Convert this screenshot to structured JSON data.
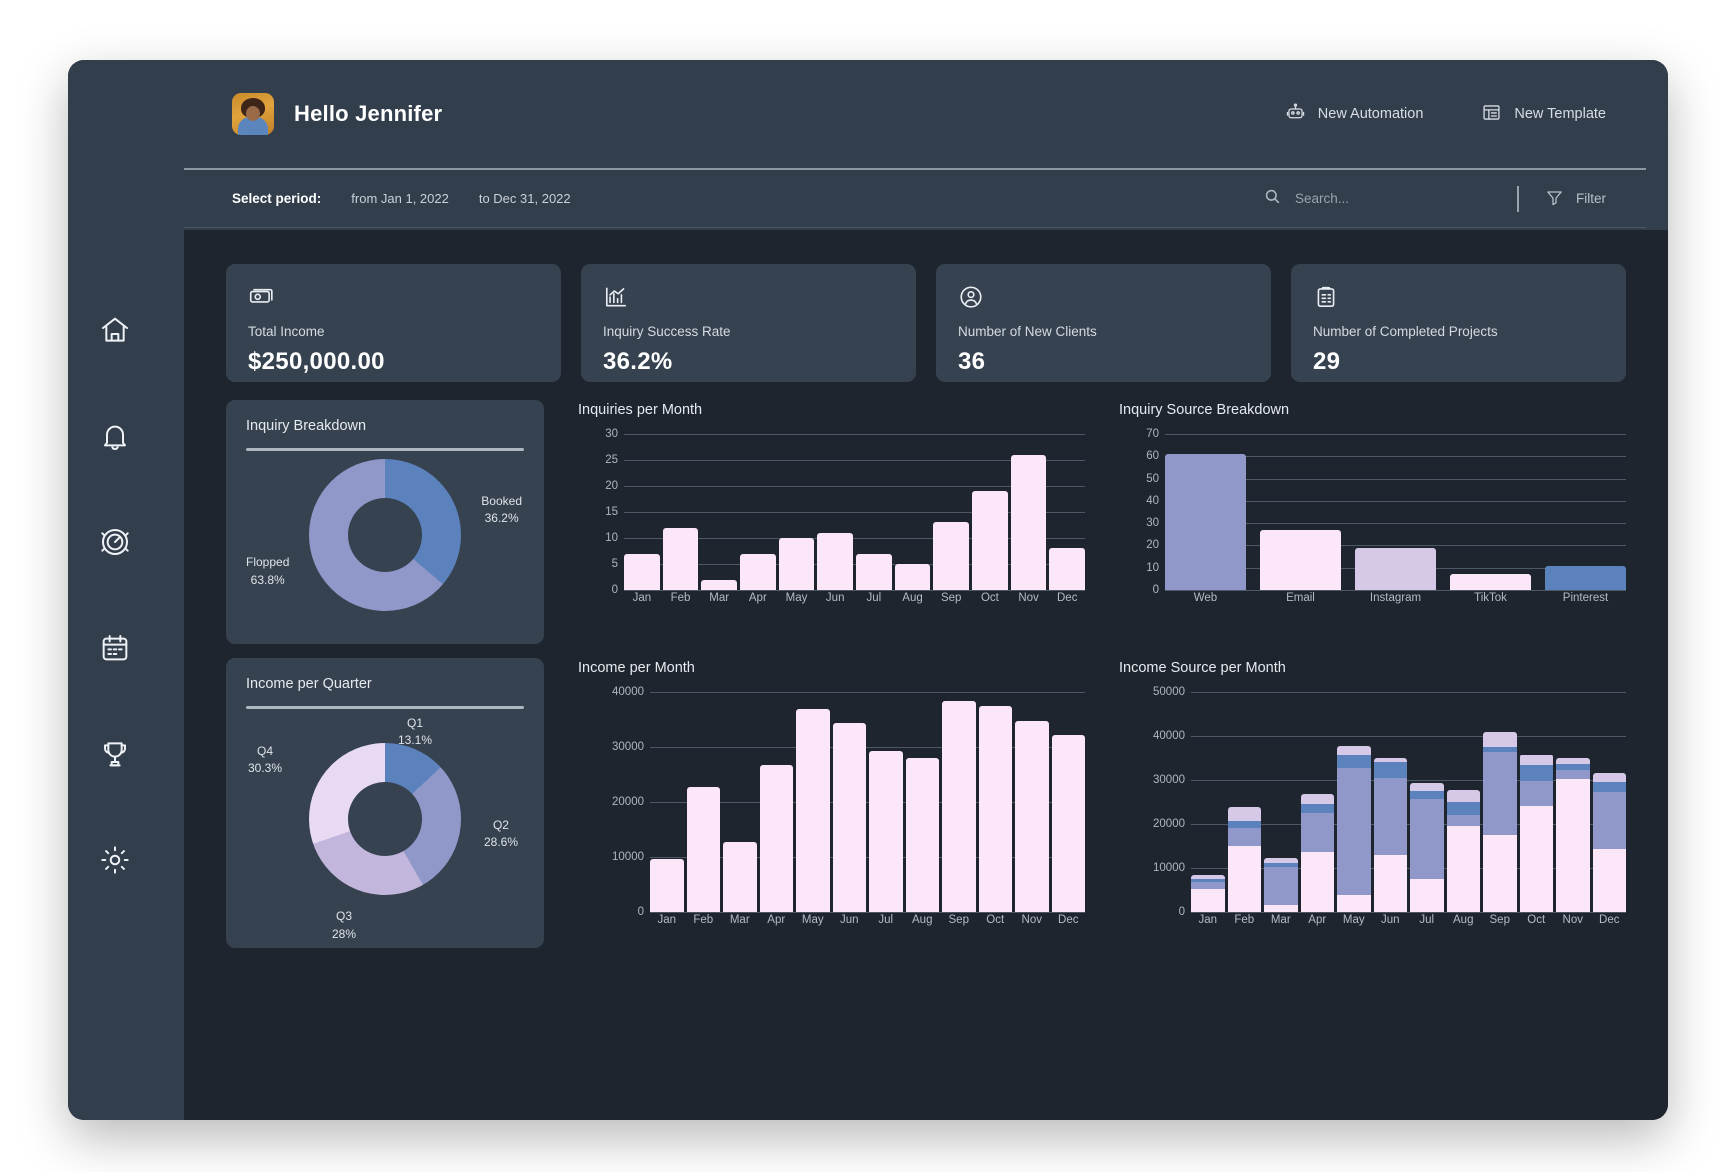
{
  "sidebar": {
    "items": [
      {
        "name": "home",
        "icon": "home-icon"
      },
      {
        "name": "notifications",
        "icon": "bell-icon"
      },
      {
        "name": "performance",
        "icon": "gauge-icon"
      },
      {
        "name": "calendar",
        "icon": "calendar-icon"
      },
      {
        "name": "awards",
        "icon": "trophy-icon"
      },
      {
        "name": "settings",
        "icon": "gear-icon"
      }
    ]
  },
  "header": {
    "greeting": "Hello Jennifer",
    "avatar_alt": "user-avatar",
    "actions": [
      {
        "label": "New Automation",
        "icon": "robot-icon"
      },
      {
        "label": "New Template",
        "icon": "template-icon"
      }
    ]
  },
  "period": {
    "label": "Select period:",
    "from": "from Jan 1, 2022",
    "to": "to Dec 31, 2022",
    "search_placeholder": "Search...",
    "search_value": "",
    "filter_label": "Filter"
  },
  "kpis": [
    {
      "icon": "money-icon",
      "label": "Total Income",
      "value": "$250,000.00"
    },
    {
      "icon": "chart-icon",
      "label": "Inquiry Success Rate",
      "value": "36.2%"
    },
    {
      "icon": "user-icon",
      "label": "Number of New Clients",
      "value": "36"
    },
    {
      "icon": "clipboard-icon",
      "label": "Number of Completed Projects",
      "value": "29"
    }
  ],
  "colors": {
    "pink": "#fbe7f8",
    "lavender": "#d6c9e8",
    "periwinkle": "#9098c9",
    "blue": "#5c82bd",
    "panel": "#36424f",
    "bg": "#1e252e",
    "chrome": "#323e4c"
  },
  "chart_data": [
    {
      "id": "inquiry-breakdown",
      "type": "pie",
      "title": "Inquiry Breakdown",
      "categories": [
        "Booked",
        "Flopped"
      ],
      "values": [
        36.2,
        63.8
      ],
      "labels": [
        "36.2%",
        "63.8%"
      ],
      "colors": [
        "#5c82bd",
        "#9098c9"
      ],
      "donut": true,
      "legend": "callout-labels"
    },
    {
      "id": "inquiries-per-month",
      "type": "bar",
      "title": "Inquiries per Month",
      "categories": [
        "Jan",
        "Feb",
        "Mar",
        "Apr",
        "May",
        "Jun",
        "Jul",
        "Aug",
        "Sep",
        "Oct",
        "Nov",
        "Dec"
      ],
      "values": [
        7,
        12,
        2,
        7,
        10,
        11,
        7,
        5,
        13,
        19,
        26,
        8
      ],
      "ylabel": "",
      "xlabel": "",
      "ylim": [
        0,
        30
      ],
      "yticks": [
        0,
        5,
        10,
        15,
        20,
        25,
        30
      ],
      "grid": true,
      "color": "#fbe7f8"
    },
    {
      "id": "inquiry-source-breakdown",
      "type": "bar",
      "title": "Inquiry Source Breakdown",
      "categories": [
        "Web",
        "Email",
        "Instagram",
        "TikTok",
        "Pinterest"
      ],
      "values": [
        61,
        27,
        19,
        7,
        11
      ],
      "ylim": [
        0,
        70
      ],
      "yticks": [
        0,
        10,
        20,
        30,
        40,
        50,
        60,
        70
      ],
      "grid": true,
      "colors": [
        "#9098c9",
        "#fbe7f8",
        "#d6c9e8",
        "#fbe7f8",
        "#5c82bd"
      ]
    },
    {
      "id": "income-per-quarter",
      "type": "pie",
      "title": "Income per Quarter",
      "categories": [
        "Q1",
        "Q2",
        "Q3",
        "Q4"
      ],
      "values": [
        13.1,
        28.6,
        28.0,
        30.3
      ],
      "labels": [
        "13.1%",
        "28.6%",
        "28%",
        "30.3%"
      ],
      "colors": [
        "#5c82bd",
        "#9098c9",
        "#c3b6dd",
        "#e7daf2"
      ],
      "donut": true,
      "legend": "callout-labels"
    },
    {
      "id": "income-per-month",
      "type": "bar",
      "title": "Income per Month",
      "categories": [
        "Jan",
        "Feb",
        "Mar",
        "Apr",
        "May",
        "Jun",
        "Jul",
        "Aug",
        "Sep",
        "Oct",
        "Nov",
        "Dec"
      ],
      "values": [
        9700,
        22800,
        12800,
        26700,
        37000,
        34300,
        29200,
        28000,
        38400,
        37400,
        34700,
        32200
      ],
      "ylim": [
        0,
        40000
      ],
      "yticks": [
        0,
        10000,
        20000,
        30000,
        40000
      ],
      "grid": true,
      "color": "#fbe7f8"
    },
    {
      "id": "income-source-per-month",
      "type": "bar",
      "stacked": true,
      "title": "Income Source per Month",
      "categories": [
        "Jan",
        "Feb",
        "Mar",
        "Apr",
        "May",
        "Jun",
        "Jul",
        "Aug",
        "Sep",
        "Oct",
        "Nov",
        "Dec"
      ],
      "series": [
        {
          "name": "Pink",
          "color": "#fbe7f8",
          "values": [
            5200,
            15000,
            1500,
            13600,
            3800,
            13000,
            7400,
            19600,
            17400,
            24200,
            30300,
            14400
          ]
        },
        {
          "name": "Periwinkle",
          "color": "#9098c9",
          "values": [
            1600,
            4200,
            8800,
            8900,
            29000,
            17500,
            18300,
            2400,
            19000,
            5600,
            2000,
            12800
          ]
        },
        {
          "name": "Blue",
          "color": "#5c82bd",
          "values": [
            700,
            1600,
            800,
            2100,
            2900,
            3500,
            1900,
            3000,
            1100,
            3700,
            1400,
            2400
          ]
        },
        {
          "name": "Lavender",
          "color": "#d6c9e8",
          "values": [
            900,
            3000,
            1100,
            2300,
            2000,
            900,
            1700,
            2800,
            3400,
            2300,
            1400,
            1900
          ]
        }
      ],
      "ylim": [
        0,
        50000
      ],
      "yticks": [
        0,
        10000,
        20000,
        30000,
        40000,
        50000
      ],
      "grid": true
    }
  ]
}
